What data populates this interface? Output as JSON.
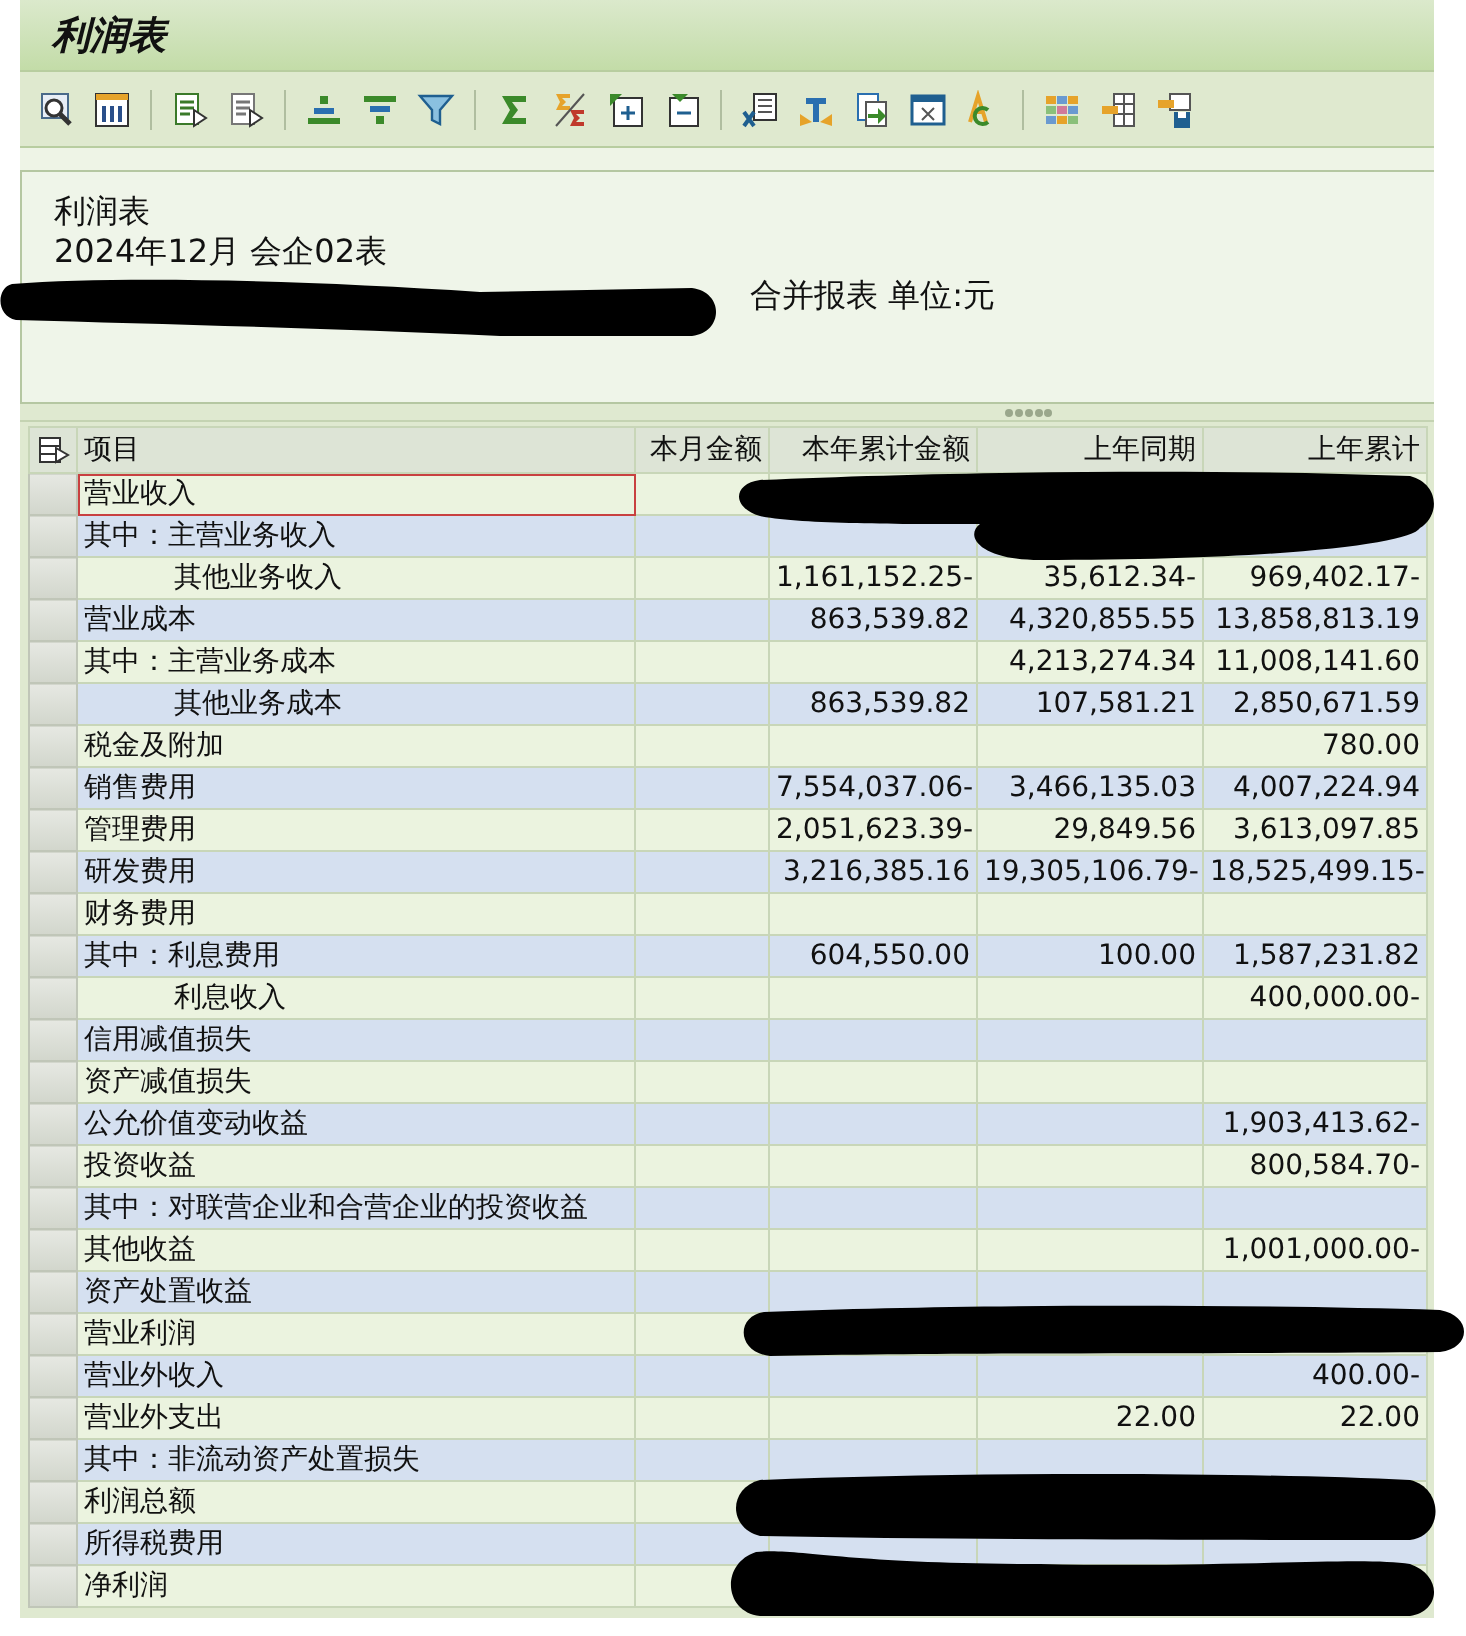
{
  "window": {
    "title": "利润表"
  },
  "header": {
    "lines": [
      "利润表",
      "2024年12月 会企02表",
      "合并报表 单位:元"
    ]
  },
  "table": {
    "columns": [
      "项目",
      "本月金额",
      "本年累计金额",
      "上年同期",
      "上年累计"
    ],
    "rows": [
      {
        "label": "营业收入",
        "kind": "item",
        "selected": true
      },
      {
        "label": "其中：主营业务收入",
        "kind": "item",
        "selected": false
      },
      {
        "label": "其他业务收入",
        "kind": "sub",
        "selected": false,
        "ytd": "1,161,152.25-",
        "prior_period": "35,612.34-",
        "prior_ytd": "969,402.17-"
      },
      {
        "label": "营业成本",
        "kind": "item",
        "selected": false,
        "ytd": "863,539.82",
        "prior_period": "4,320,855.55",
        "prior_ytd": "13,858,813.19"
      },
      {
        "label": "其中：主营业务成本",
        "kind": "item",
        "selected": false,
        "prior_period": "4,213,274.34",
        "prior_ytd": "11,008,141.60"
      },
      {
        "label": "其他业务成本",
        "kind": "sub",
        "selected": false,
        "ytd": "863,539.82",
        "prior_period": "107,581.21",
        "prior_ytd": "2,850,671.59"
      },
      {
        "label": "税金及附加",
        "kind": "item",
        "selected": false,
        "prior_ytd": "780.00"
      },
      {
        "label": "销售费用",
        "kind": "item",
        "selected": false,
        "ytd": "7,554,037.06-",
        "prior_period": "3,466,135.03",
        "prior_ytd": "4,007,224.94"
      },
      {
        "label": "管理费用",
        "kind": "item",
        "selected": false,
        "ytd": "2,051,623.39-",
        "prior_period": "29,849.56",
        "prior_ytd": "3,613,097.85"
      },
      {
        "label": "研发费用",
        "kind": "item",
        "selected": false,
        "ytd": "3,216,385.16",
        "prior_period": "19,305,106.79-",
        "prior_ytd": "18,525,499.15-"
      },
      {
        "label": "财务费用",
        "kind": "item",
        "selected": false
      },
      {
        "label": "其中：利息费用",
        "kind": "item",
        "selected": false,
        "ytd": "604,550.00",
        "prior_period": "100.00",
        "prior_ytd": "1,587,231.82"
      },
      {
        "label": "利息收入",
        "kind": "sub",
        "selected": false,
        "prior_ytd": "400,000.00-"
      },
      {
        "label": "信用减值损失",
        "kind": "item",
        "selected": false
      },
      {
        "label": "资产减值损失",
        "kind": "item",
        "selected": false
      },
      {
        "label": "公允价值变动收益",
        "kind": "item",
        "selected": false,
        "prior_ytd": "1,903,413.62-"
      },
      {
        "label": "投资收益",
        "kind": "item",
        "selected": false,
        "prior_ytd": "800,584.70-"
      },
      {
        "label": "其中：对联营企业和合营企业的投资收益",
        "kind": "item",
        "selected": false
      },
      {
        "label": "其他收益",
        "kind": "item",
        "selected": false,
        "prior_ytd": "1,001,000.00-"
      },
      {
        "label": "资产处置收益",
        "kind": "item",
        "selected": false
      },
      {
        "label": "营业利润",
        "kind": "item",
        "selected": false
      },
      {
        "label": "营业外收入",
        "kind": "item",
        "selected": false,
        "prior_ytd": "400.00-"
      },
      {
        "label": "营业外支出",
        "kind": "item",
        "selected": false,
        "prior_period": "22.00",
        "prior_ytd": "22.00"
      },
      {
        "label": "其中：非流动资产处置损失",
        "kind": "item",
        "selected": false
      },
      {
        "label": "利润总额",
        "kind": "item",
        "selected": false
      },
      {
        "label": "所得税费用",
        "kind": "item",
        "selected": false
      },
      {
        "label": "净利润",
        "kind": "item",
        "selected": false
      }
    ]
  }
}
